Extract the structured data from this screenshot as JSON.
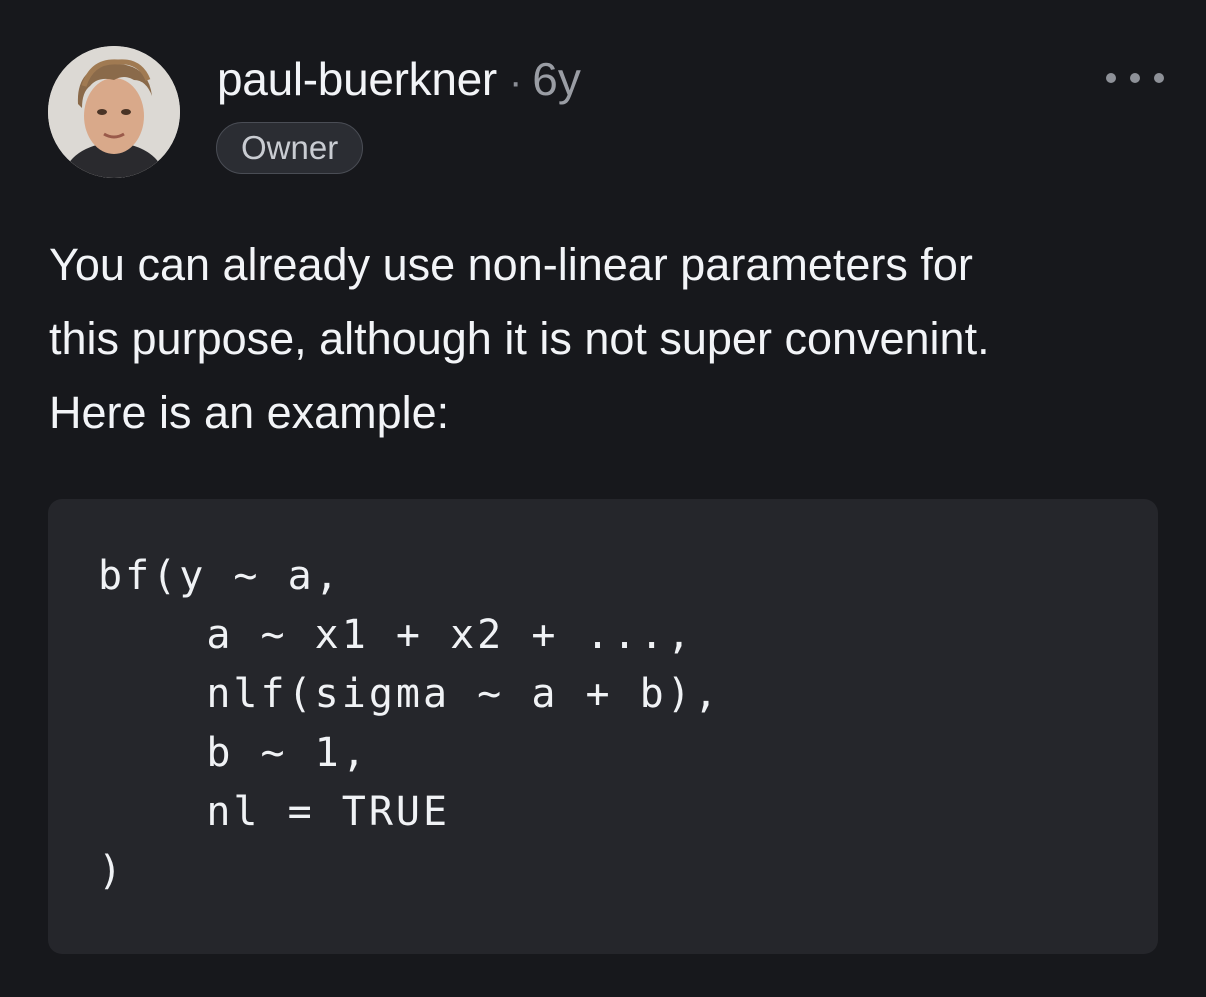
{
  "comment": {
    "author": "paul-buerkner",
    "separator": "·",
    "age": "6y",
    "role_badge": "Owner",
    "more_icon": "more-horizontal-icon",
    "body_lines": [
      "You can already use non-linear parameters for",
      "this purpose, although it is not super convenint.",
      "Here is an example:"
    ],
    "code_lines": [
      "bf(y ~ a,",
      "    a ~ x1 + x2 + ...,",
      "    nlf(sigma ~ a + b),",
      "    b ~ 1,",
      "    nl = TRUE",
      ")"
    ]
  },
  "colors": {
    "background": "#17181c",
    "code_background": "#25262b",
    "text": "#f2f4f7",
    "muted": "#9a9da4"
  }
}
